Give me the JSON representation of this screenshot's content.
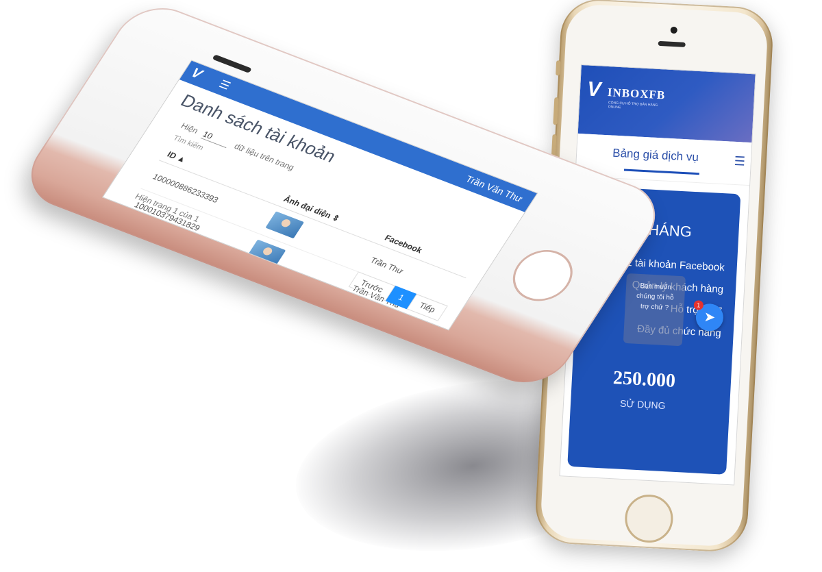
{
  "right_phone": {
    "logo": {
      "mark": "V",
      "word": "INBOXFB",
      "tagline": "CÔNG CỤ HỖ TRỢ BÁN HÀNG ONLINE"
    },
    "section_title": "Bảng giá dịch vụ",
    "menu_icon": "hamburger-icon",
    "plan": {
      "name": "1 THÁNG",
      "features": [
        "1 tài khoản Facebook",
        "Quản lý khách hàng",
        "Hỗ trợ 24/7",
        "Đầy đủ chức năng"
      ],
      "price": "250.000",
      "cta": "SỬ DỤNG"
    },
    "chat_prompt": [
      "Bạn muốn",
      "chúng tôi hỗ",
      "trợ chứ ?"
    ],
    "messenger": {
      "icon": "messenger-icon",
      "badge": "1"
    }
  },
  "left_phone": {
    "header": {
      "logo": "V",
      "menu_icon": "hamburger-icon",
      "user": "Trần Văn Thư"
    },
    "page_title": "Danh sách tài khoản",
    "controls": {
      "prefix": "Hiện",
      "page_size": "10",
      "suffix": "dữ liệu trên trang"
    },
    "search_label": "Tìm kiếm",
    "table": {
      "headers": [
        "ID ▲",
        "Ảnh đại diện ⇕",
        "Facebook"
      ],
      "rows": [
        {
          "id": "100000886233393",
          "name": "Trần Thư"
        },
        {
          "id": "100010379431829",
          "name": "Trần Văn Thư"
        }
      ]
    },
    "footer": "Hiện trang 1 của 1",
    "pager": {
      "prev": "Trước",
      "current": "1",
      "next": "Tiếp"
    }
  }
}
